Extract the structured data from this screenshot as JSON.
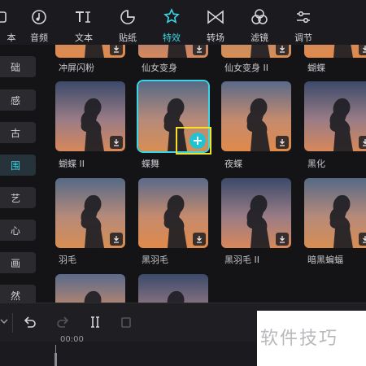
{
  "topbar": {
    "tabs": [
      {
        "label": "本",
        "icon": "media-icon"
      },
      {
        "label": "音频",
        "icon": "audio-icon"
      },
      {
        "label": "文本",
        "icon": "text-icon"
      },
      {
        "label": "贴纸",
        "icon": "sticker-icon"
      },
      {
        "label": "特效",
        "icon": "effects-icon",
        "active": true
      },
      {
        "label": "转场",
        "icon": "transition-icon"
      },
      {
        "label": "滤镜",
        "icon": "filter-icon"
      },
      {
        "label": "调节",
        "icon": "adjust-icon"
      }
    ]
  },
  "sidebar": {
    "categories": [
      {
        "label": "础"
      },
      {
        "label": "感"
      },
      {
        "label": "古"
      },
      {
        "label": "围",
        "active": true
      },
      {
        "label": "艺"
      },
      {
        "label": "心"
      },
      {
        "label": "画"
      },
      {
        "label": "然"
      }
    ]
  },
  "effects": {
    "row1": [
      "冲屏闪粉",
      "仙女变身",
      "仙女变身 II",
      "蝴蝶"
    ],
    "row2": [
      "蝴蝶 II",
      "蝶舞",
      "夜蝶",
      "黑化"
    ],
    "row3": [
      "羽毛",
      "黑羽毛",
      "黑羽毛 II",
      "暗黑蝙蝠"
    ],
    "add_symbol": "+"
  },
  "timeline": {
    "timecode": "00:00"
  },
  "watermark": {
    "text": "软件技巧"
  },
  "colors": {
    "accent": "#3cd5e6",
    "highlight_box": "#f5e228"
  }
}
